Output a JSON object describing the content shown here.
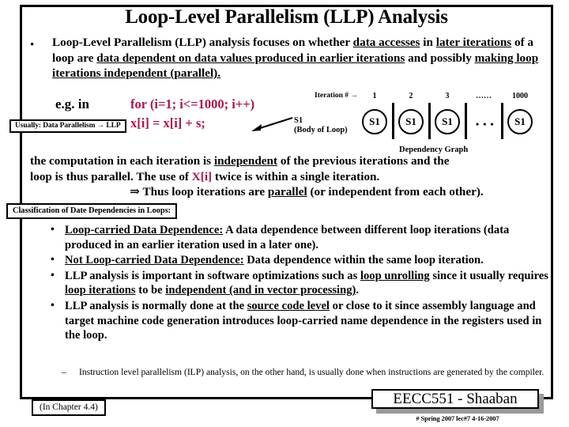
{
  "slide": {
    "title": "Loop-Level Parallelism (LLP) Analysis",
    "intro": {
      "bullet_glyph": "•",
      "parts": [
        {
          "text": "Loop-Level Parallelism (LLP) analysis focuses on whether ",
          "underline": false
        },
        {
          "text": "data accesses",
          "underline": true
        },
        {
          "text": " in ",
          "underline": false
        },
        {
          "text": "later iterations",
          "underline": true
        },
        {
          "text": " of a loop are ",
          "underline": false
        },
        {
          "text": "data dependent on data values produced in earlier iterations",
          "underline": true
        },
        {
          "text": " and possibly ",
          "underline": false
        },
        {
          "text": "making loop iterations independent (parallel).",
          "underline": true
        }
      ]
    },
    "example": {
      "eg_label": "e.g.  in",
      "code_line1": "for (i=1; i<=1000; i++)",
      "code_line2": "x[i] = x[i] + s;",
      "code_color": "#A8184A",
      "callout_line1": "S1",
      "callout_line2": "(Body of Loop)",
      "usually_box": "Usually:   Data Parallelism → LLP"
    },
    "dependency_graph": {
      "iteration_label": "Iteration #  →",
      "caption": "Dependency Graph",
      "node_label": "S1",
      "iterations": [
        "1",
        "2",
        "3",
        "……",
        "1000"
      ],
      "mid_ellipsis": "• • •"
    },
    "middle_paragraph": {
      "line1_a": "the computation in each iteration is ",
      "line1_underlined": "independent",
      "line1_b": " of the  previous iterations and the",
      "line2_a": "loop is thus parallel. The use of ",
      "line2_code": "X[i]",
      "line2_b": "  twice is within a single iteration.",
      "line3_a": "⇒ Thus loop iterations are ",
      "line3_underlined": "parallel",
      "line3_b": " (or independent from each other)."
    },
    "classification_box": "Classification of Date Dependencies in Loops:",
    "bullets": [
      {
        "glyph": "•",
        "parts": [
          {
            "text": "Loop-carried Data Dependence:",
            "underline": true
          },
          {
            "text": "  A data dependence between different loop iterations (data produced in an earlier iteration used in a later one).",
            "underline": false
          }
        ]
      },
      {
        "glyph": "•",
        "parts": [
          {
            "text": "Not Loop-carried Data Dependence:",
            "underline": true
          },
          {
            "text": "  Data dependence within the same loop iteration.",
            "underline": false
          }
        ]
      },
      {
        "glyph": "•",
        "parts": [
          {
            "text": "LLP analysis is important in software optimizations such as  ",
            "underline": false
          },
          {
            "text": "loop unrolling",
            "underline": true
          },
          {
            "text": " since it usually requires ",
            "underline": false
          },
          {
            "text": "loop iterations",
            "underline": true
          },
          {
            "text": " to be ",
            "underline": false
          },
          {
            "text": "independent (and in vector processing)",
            "underline": true
          },
          {
            "text": ".",
            "underline": false
          }
        ]
      },
      {
        "glyph": "•",
        "parts": [
          {
            "text": "LLP analysis is normally done at the ",
            "underline": false
          },
          {
            "text": "source code level",
            "underline": true
          },
          {
            "text": " or close to it since assembly language and target machine code generation introduces  loop-carried name dependence in the registers used in the loop.",
            "underline": false
          }
        ]
      }
    ],
    "sub_bullet": {
      "dash": "–",
      "text": "Instruction level parallelism (ILP) analysis, on the other hand, is usually done when instructions are generated by the compiler."
    },
    "footer": {
      "chapter_note": "(In  Chapter 4.4)",
      "badge": "EECC551 - Shaaban",
      "sub": "#  Spring 2007 lec#7   4-16-2007"
    }
  }
}
